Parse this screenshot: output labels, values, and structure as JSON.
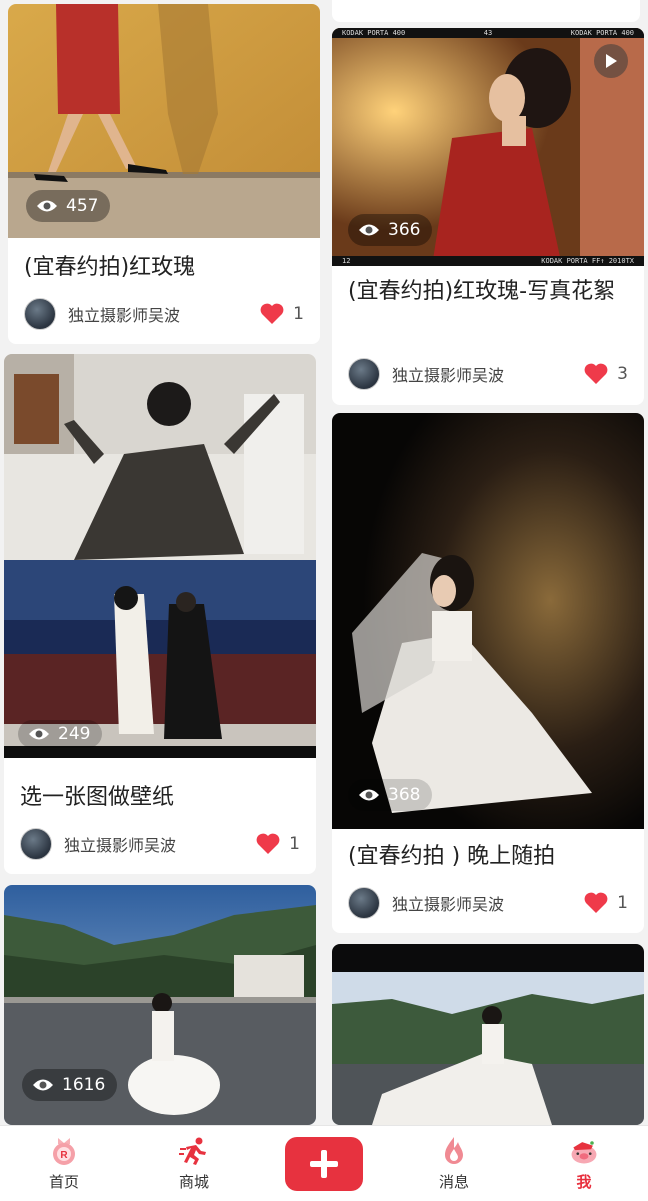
{
  "feed": {
    "left": [
      {
        "title": "(宜春约拍)红玫瑰",
        "author": "独立摄影师吴波",
        "views": "457",
        "likes": "1"
      },
      {
        "title": "选一张图做壁纸",
        "author": "独立摄影师吴波",
        "views": "249",
        "likes": "1"
      },
      {
        "title": "",
        "author": "",
        "views": "1616",
        "likes": ""
      }
    ],
    "right": [
      {
        "title": "(宜春约拍)红玫瑰-写真花絮",
        "author": "独立摄影师吴波",
        "views": "366",
        "likes": "3"
      },
      {
        "title": "(宜春约拍 ) 晚上随拍",
        "author": "独立摄影师吴波",
        "views": "368",
        "likes": "1"
      }
    ]
  },
  "film_strip": {
    "top_left": "KODAK PORTA 400",
    "top_mid": "43",
    "top_right": "KODAK PORTA 400",
    "bottom_left": "12",
    "bottom_right": "KODAK PORTA  FF↑ 2010TX"
  },
  "tabbar": {
    "home": "首页",
    "mall": "商城",
    "messages": "消息",
    "me": "我"
  },
  "colors": {
    "accent": "#e7323f",
    "heart": "#ef3a4a"
  }
}
